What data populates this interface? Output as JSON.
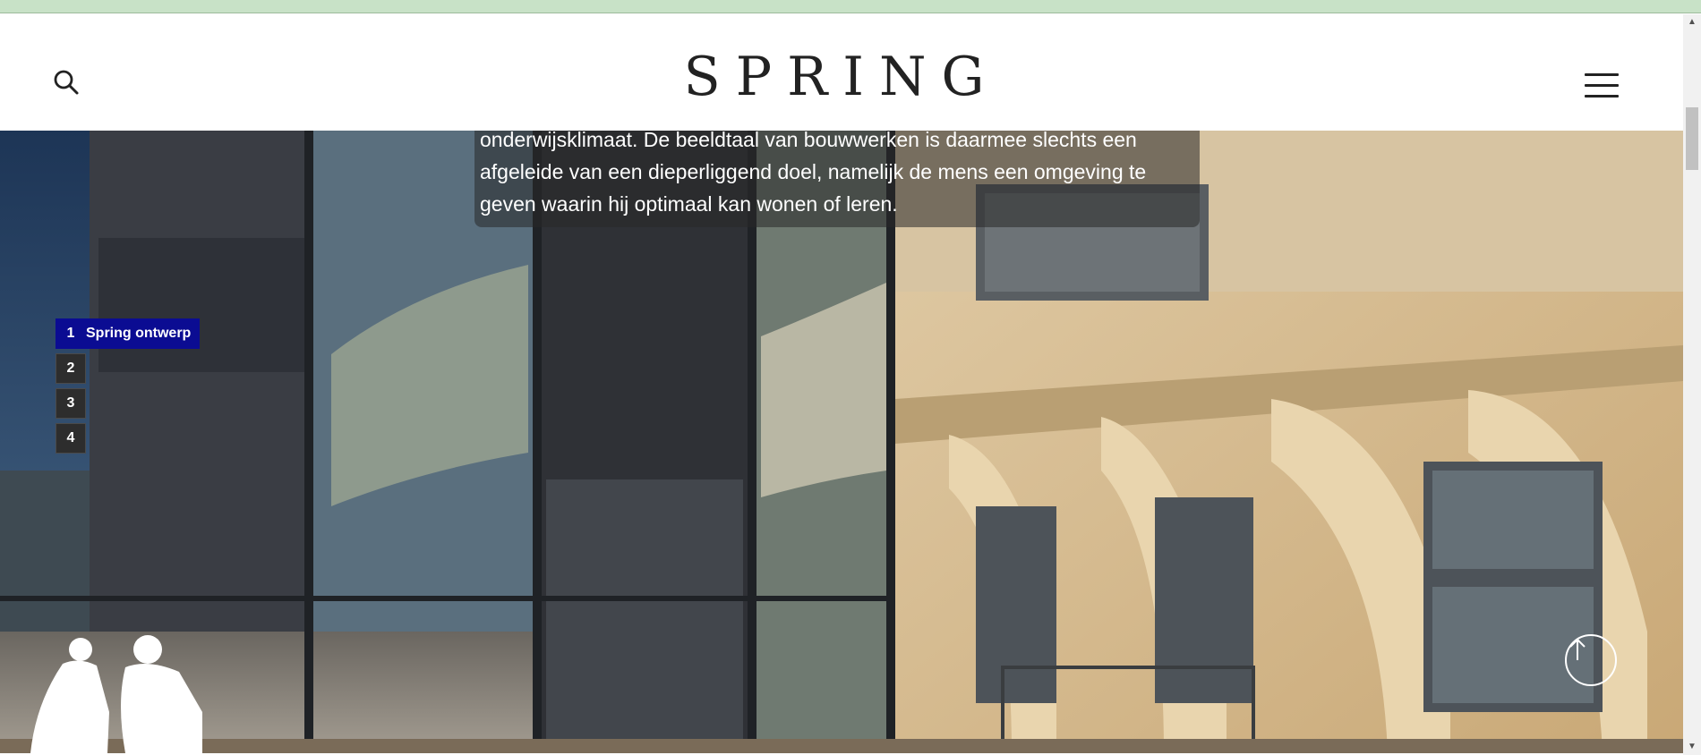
{
  "header": {
    "logo": "SPRING",
    "search_icon": "search-icon",
    "menu_icon": "hamburger-menu-icon"
  },
  "hero": {
    "paragraph_lines": [
      "onderwijsklimaat. De beeldtaal van bouwwerken is daarmee slechts een",
      "afgeleide van een dieperliggend doel, namelijk de mens een omgeving te",
      "geven waarin hij optimaal kan wonen of leren."
    ]
  },
  "steps": [
    {
      "num": "1",
      "label": "Spring ontwerp",
      "active": true
    },
    {
      "num": "2",
      "label": "",
      "active": false
    },
    {
      "num": "3",
      "label": "",
      "active": false
    },
    {
      "num": "4",
      "label": "",
      "active": false
    }
  ],
  "scroll_top_icon": "arrow-up-icon",
  "colors": {
    "accent": "#0b0c92",
    "top_strip": "#c8e2c7"
  }
}
